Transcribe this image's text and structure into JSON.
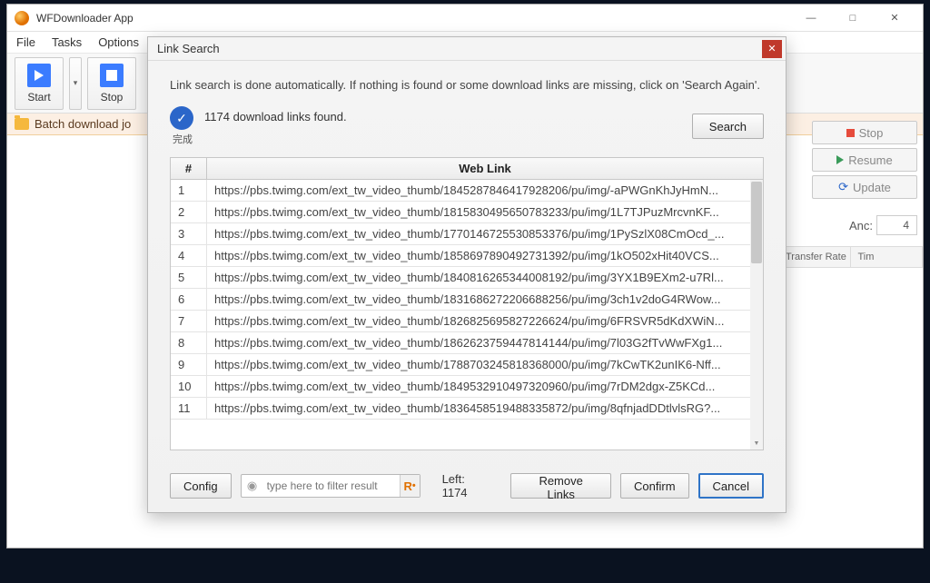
{
  "window": {
    "title": "WFDownloader App",
    "menus": [
      "File",
      "Tasks",
      "Options"
    ],
    "toolbar": {
      "start": "Start",
      "stop": "Stop"
    },
    "job_row_label": "Batch download jo",
    "right_buttons": {
      "stop": "Stop",
      "resume": "Resume",
      "update": "Update"
    },
    "anc_label": "Anc:",
    "anc_value": "4",
    "grid_columns": [
      "Transfer Rate",
      "Tim"
    ]
  },
  "dialog": {
    "title": "Link Search",
    "info": "Link search is done automatically. If nothing is found or some download links are missing, click on 'Search Again'.",
    "found_text": "1174 download links found.",
    "status_sub": "完成",
    "search_btn": "Search",
    "columns": {
      "num": "#",
      "link": "Web Link"
    },
    "rows": [
      {
        "n": "1",
        "url": "https://pbs.twimg.com/ext_tw_video_thumb/1845287846417928206/pu/img/-aPWGnKhJyHmN..."
      },
      {
        "n": "2",
        "url": "https://pbs.twimg.com/ext_tw_video_thumb/1815830495650783233/pu/img/1L7TJPuzMrcvnKF..."
      },
      {
        "n": "3",
        "url": "https://pbs.twimg.com/ext_tw_video_thumb/1770146725530853376/pu/img/1PySzlX08CmOcd_..."
      },
      {
        "n": "4",
        "url": "https://pbs.twimg.com/ext_tw_video_thumb/1858697890492731392/pu/img/1kO502xHit40VCS..."
      },
      {
        "n": "5",
        "url": "https://pbs.twimg.com/ext_tw_video_thumb/1840816265344008192/pu/img/3YX1B9EXm2-u7Rl..."
      },
      {
        "n": "6",
        "url": "https://pbs.twimg.com/ext_tw_video_thumb/1831686272206688256/pu/img/3ch1v2doG4RWow..."
      },
      {
        "n": "7",
        "url": "https://pbs.twimg.com/ext_tw_video_thumb/1826825695827226624/pu/img/6FRSVR5dKdXWiN..."
      },
      {
        "n": "8",
        "url": "https://pbs.twimg.com/ext_tw_video_thumb/1862623759447814144/pu/img/7l03G2fTvWwFXg1..."
      },
      {
        "n": "9",
        "url": "https://pbs.twimg.com/ext_tw_video_thumb/1788703245818368000/pu/img/7kCwTK2unIK6-Nff..."
      },
      {
        "n": "10",
        "url": "https://pbs.twimg.com/ext_tw_video_thumb/1849532910497320960/pu/img/7rDM2dgx-Z5KCd..."
      },
      {
        "n": "11",
        "url": "https://pbs.twimg.com/ext_tw_video_thumb/1836458519488335872/pu/img/8qfnjadDDtlvlsRG?..."
      }
    ],
    "footer": {
      "config": "Config",
      "filter_placeholder": "type here to filter result",
      "left_label": "Left: 1174",
      "remove": "Remove Links",
      "confirm": "Confirm",
      "cancel": "Cancel"
    }
  }
}
